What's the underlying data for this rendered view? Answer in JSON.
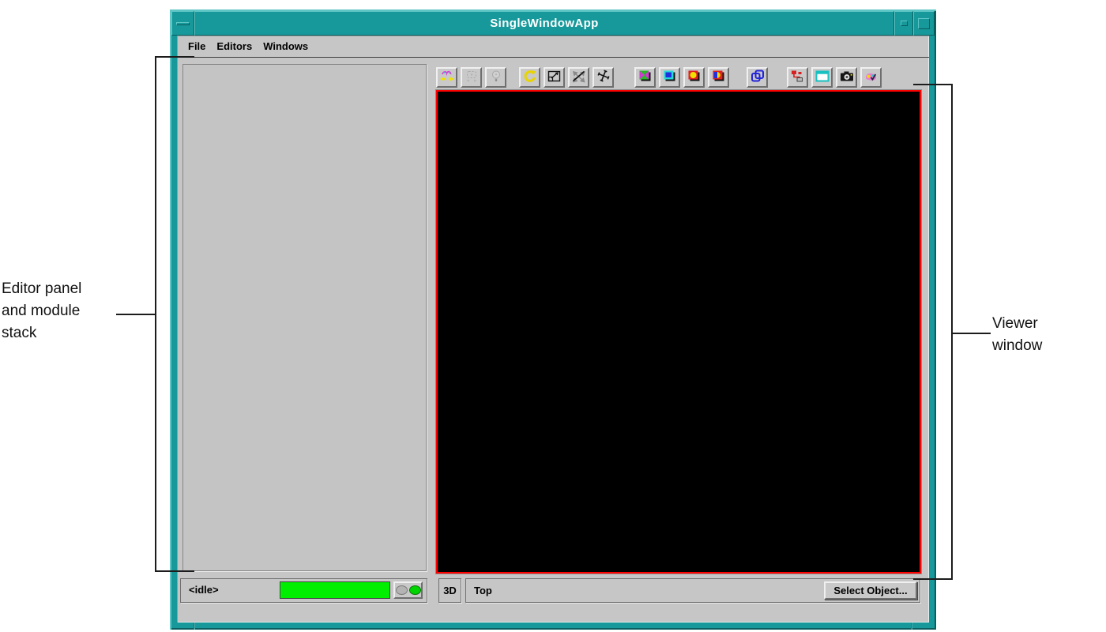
{
  "annotations": {
    "left_lines": [
      "Editor panel",
      "and module",
      "stack"
    ],
    "right_lines": [
      "Viewer",
      "window"
    ]
  },
  "window": {
    "title": "SingleWindowApp",
    "menu_items": [
      "File",
      "Editors",
      "Windows"
    ],
    "toolbar_icons": [
      "connect-modules",
      "drag-module",
      "headlight",
      "rotate-mode",
      "scale-mode",
      "pan-mode",
      "translate-mode",
      "view-style-bowtie",
      "view-style-square",
      "view-style-circle",
      "view-style-half",
      "copy-view",
      "object-hierarchy",
      "viewer-window",
      "snapshot",
      "edit-view-properties"
    ],
    "status_left": {
      "label": "<idle>",
      "progress_percent": 100
    },
    "status_right": {
      "mode_button": "3D",
      "view_name": "Top",
      "select_button": "Select Object..."
    }
  },
  "colors": {
    "frame_teal": "#17999b",
    "ui_gray": "#c6c6c6",
    "viewer_border": "#ff0000",
    "viewer_bg": "#000000",
    "progress_green": "#00ee00",
    "title_text": "#ffffff"
  }
}
